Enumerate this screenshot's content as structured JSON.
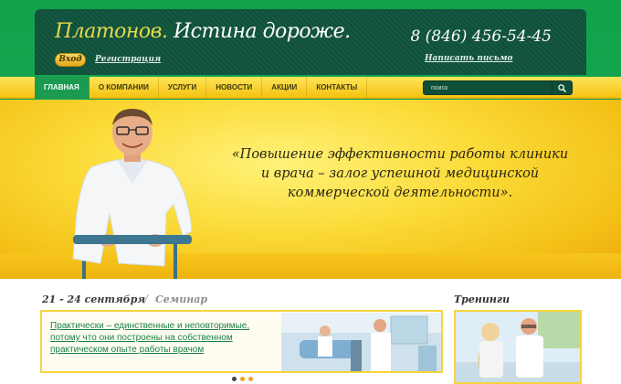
{
  "header": {
    "logo_main": "Платонов.",
    "logo_tagline": "Истина дороже.",
    "login_label": "Вход",
    "register_label": "Регистрация",
    "phone": "8 (846) 456-54-45",
    "write_label": "Написать письмо"
  },
  "nav": {
    "items": [
      {
        "label": "ГЛАВНАЯ"
      },
      {
        "label": "О КОМПАНИИ"
      },
      {
        "label": "УСЛУГИ"
      },
      {
        "label": "НОВОСТИ"
      },
      {
        "label": "АКЦИИ"
      },
      {
        "label": "КОНТАКТЫ"
      }
    ],
    "active_index": 0,
    "search_placeholder": "поиск"
  },
  "banner": {
    "quote": "«Повышение эффективности работы клиники и врача – залог успешной медицинской коммерческой деятельности»."
  },
  "event": {
    "date": "21 - 24 сентября",
    "separator": "/",
    "type": "Семинар",
    "text": "Практически – единственные и неповторимые, потому что они построены на собственном практическом опыте работы врачом"
  },
  "slider": {
    "count": 3,
    "active_index": 0
  },
  "trainings": {
    "title": "Тренинги"
  },
  "colors": {
    "brand_green": "#1aa957",
    "header_dark": "#10533c",
    "nav_yellow": "#f4c20f",
    "link_green": "#1d7f44"
  }
}
